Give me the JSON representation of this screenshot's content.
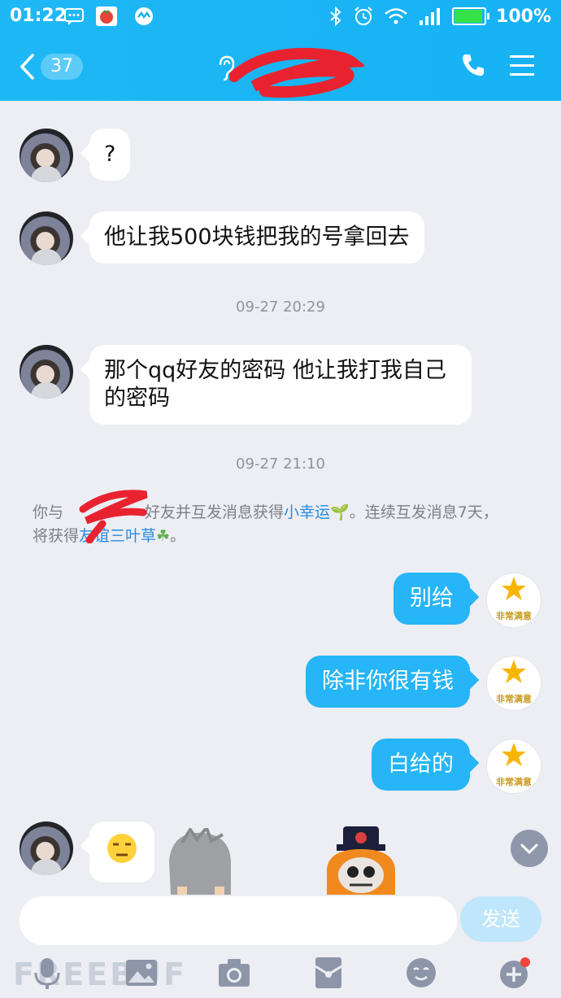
{
  "status_bar": {
    "time": "01:22",
    "battery": "100%",
    "battery_fraction": 1.0
  },
  "header": {
    "unread_count": "37",
    "contact_name": ""
  },
  "messages": [
    {
      "side": "in",
      "text": "?"
    },
    {
      "side": "in",
      "text": "他让我500块钱把我的号拿回去"
    },
    {
      "timestamp": "09-27 20:29"
    },
    {
      "side": "in",
      "text": "那个qq好友的密码 他让我打我自己的密码"
    },
    {
      "timestamp": "09-27 21:10"
    },
    {
      "system": {
        "prefix": "你与",
        "mid": "好友并互发消息获得",
        "link1": "小幸运",
        "after1": "。连续互发消息7天，",
        "line2_prefix": "将获得",
        "link2": "友谊三叶草",
        "after2": "。"
      }
    },
    {
      "side": "out",
      "text": "别给"
    },
    {
      "side": "out",
      "text": "除非你很有钱"
    },
    {
      "side": "out",
      "text": "白给的"
    }
  ],
  "out_avatar_label": "非常满意",
  "composer": {
    "send_label": "发送",
    "placeholder": ""
  },
  "watermark": "FREEBUF",
  "icons": [
    "back-icon",
    "ear-icon",
    "phone-icon",
    "menu-icon",
    "mic-icon",
    "image-icon",
    "camera-icon",
    "red-packet-icon",
    "emoji-icon",
    "plus-icon"
  ],
  "colors": {
    "header": "#16b2f3",
    "bubble_out": "#26b5f6",
    "link": "#2a8be0",
    "background": "#eceef4"
  }
}
